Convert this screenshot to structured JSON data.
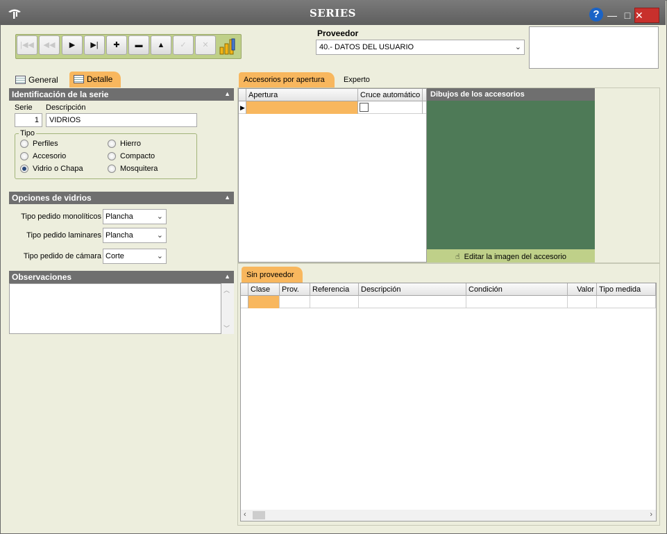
{
  "window": {
    "title": "SERIES"
  },
  "titlebar": {
    "help": "?",
    "minimize": "—",
    "maximize": "□",
    "close": "✕"
  },
  "toolbar": {
    "buttons": [
      {
        "id": "first",
        "glyph": "|◀◀",
        "enabled": false
      },
      {
        "id": "prev",
        "glyph": "◀◀",
        "enabled": false
      },
      {
        "id": "next",
        "glyph": "▶",
        "enabled": true
      },
      {
        "id": "last",
        "glyph": "▶|",
        "enabled": true
      },
      {
        "id": "add",
        "glyph": "✚",
        "enabled": true
      },
      {
        "id": "delete",
        "glyph": "▬",
        "enabled": true
      },
      {
        "id": "up",
        "glyph": "▲",
        "enabled": true
      },
      {
        "id": "confirm",
        "glyph": "✓",
        "enabled": false
      },
      {
        "id": "cancel",
        "glyph": "✕",
        "enabled": false
      }
    ]
  },
  "proveedor": {
    "label": "Proveedor",
    "value": "40.- DATOS DEL USUARIO"
  },
  "left_tabs": {
    "general": "General",
    "detalle": "Detalle"
  },
  "ident": {
    "title": "Identificación de la serie",
    "serie_label": "Serie",
    "serie_value": "1",
    "desc_label": "Descripción",
    "desc_value": "VIDRIOS",
    "tipo_label": "Tipo",
    "tipos": [
      "Perfiles",
      "Hierro",
      "Accesorio",
      "Compacto",
      "Vidrio o Chapa",
      "Mosquitera"
    ],
    "selected": "Vidrio o Chapa"
  },
  "opciones": {
    "title": "Opciones de vidrios",
    "rows": [
      {
        "label": "Tipo pedido monolíticos",
        "value": "Plancha"
      },
      {
        "label": "Tipo pedido laminares",
        "value": "Plancha"
      },
      {
        "label": "Tipo pedido de cámara",
        "value": "Corte"
      }
    ]
  },
  "observaciones": {
    "title": "Observaciones"
  },
  "right_tabs": {
    "accesorios": "Accesorios por apertura",
    "experto": "Experto"
  },
  "acc_grid": {
    "columns": [
      "Apertura",
      "Cruce automático"
    ]
  },
  "dibujos": {
    "title": "Dibujos de los accesorios",
    "edit_button": "Editar la imagen del accesorio"
  },
  "lower_tabs": {
    "sin_proveedor": "Sin proveedor"
  },
  "prov_grid": {
    "columns": [
      "Clase",
      "Prov.",
      "Referencia",
      "Descripción",
      "Condición",
      "Valor",
      "Tipo medida"
    ]
  },
  "colors": {
    "accent_orange": "#f8b75e",
    "toolbar_green": "#bfd089",
    "image_green": "#4e7a57",
    "header_gray": "#6f6f6f"
  }
}
